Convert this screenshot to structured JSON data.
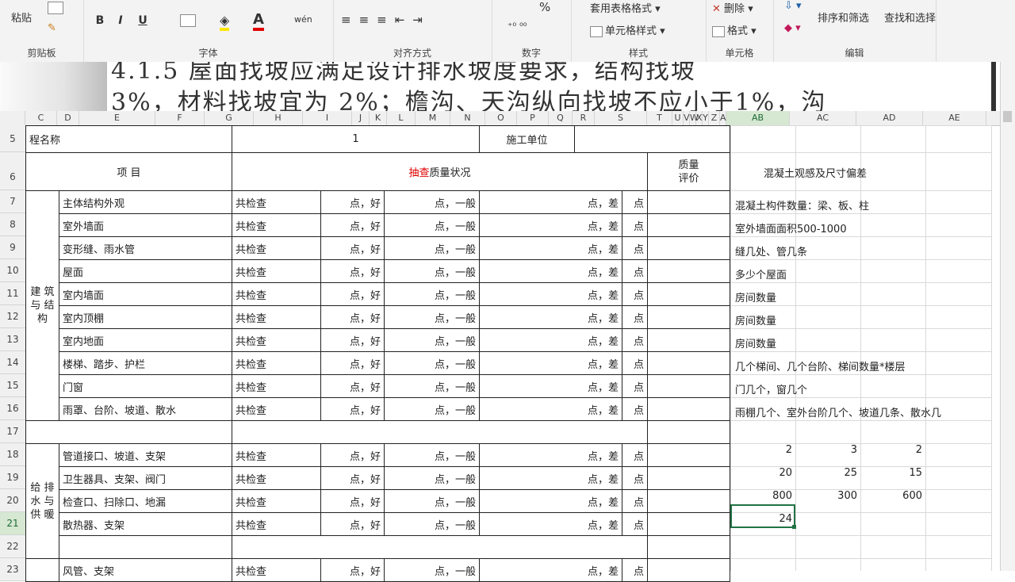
{
  "ribbon": {
    "clipboard": {
      "paste": "粘贴",
      "label": "剪贴板"
    },
    "font": {
      "bold": "B",
      "italic": "I",
      "underline": "U",
      "wen": "wén",
      "label": "字体"
    },
    "alignment": {
      "label": "对齐方式"
    },
    "number": {
      "percent": "%",
      "label": "数字"
    },
    "styles": {
      "table_format": "套用表格格式",
      "cell_style": "单元格样式",
      "label": "样式"
    },
    "cells": {
      "delete": "删除",
      "format": "格式",
      "label": "单元格"
    },
    "editing": {
      "sort_filter": "排序和筛选",
      "find_select": "查找和选择",
      "label": "编辑"
    }
  },
  "snippet": {
    "line1": "4.1.5  屋面找坡应满足设计排水坡度要求，结构找坡",
    "line2": "3%，材料找坡宜为 2%；檐沟、天沟纵向找坡不应小于1%，沟"
  },
  "columns": [
    "C",
    "D",
    "E",
    "F",
    "G",
    "H",
    "I",
    "J",
    "K",
    "L",
    "M",
    "N",
    "O",
    "P",
    "Q",
    "R",
    "S",
    "T",
    "U",
    "V",
    "W",
    "X",
    "Y",
    "Z",
    "A",
    "AB",
    "AC",
    "AD",
    "AE"
  ],
  "rows": [
    "5",
    "6",
    "7",
    "8",
    "9",
    "10",
    "11",
    "12",
    "13",
    "14",
    "15",
    "16",
    "17",
    "18",
    "19",
    "20",
    "21",
    "22",
    "23"
  ],
  "form": {
    "project_name_label": "程名称",
    "project_name_value": "1",
    "construction_unit_label": "施工单位",
    "item_header": "项        目",
    "quality_prefix": "抽查",
    "quality_suffix": "质量状况",
    "evaluation_header": "质量\n评价",
    "phrases": {
      "check": "共检查",
      "good": "点，好",
      "general": "点，一般",
      "poor": "点，差",
      "point": "点"
    },
    "category1": "建\n筑\n与\n结\n构",
    "category2": "给\n排\n水\n与\n供\n暖",
    "items1": [
      "主体结构外观",
      "室外墙面",
      "变形缝、雨水管",
      "屋面",
      "室内墙面",
      "室内顶棚",
      "室内地面",
      "楼梯、踏步、护栏",
      "门窗",
      "雨罩、台阶、坡道、散水"
    ],
    "items2": [
      "管道接口、坡道、支架",
      "卫生器具、支架、阀门",
      "检查口、扫除口、地漏",
      "散热器、支架"
    ],
    "items3": [
      "风管、支架"
    ]
  },
  "side": {
    "title": "混凝土观感及尺寸偏差",
    "notes": [
      "混凝土构件数量：梁、板、柱",
      "室外墙面面积500-1000",
      "缝几处、管几条",
      "多少个屋面",
      "房间数量",
      "房间数量",
      "房间数量",
      "几个梯间、几个台阶、梯间数量*楼层",
      "门几个，窗几个",
      "雨棚几个、室外台阶几个、坡道几条、散水几"
    ],
    "values_r18": [
      "2",
      "3",
      "2"
    ],
    "values_r19": [
      "20",
      "25",
      "15"
    ],
    "values_r20": [
      "800",
      "300",
      "600"
    ],
    "value_r21": "24"
  }
}
